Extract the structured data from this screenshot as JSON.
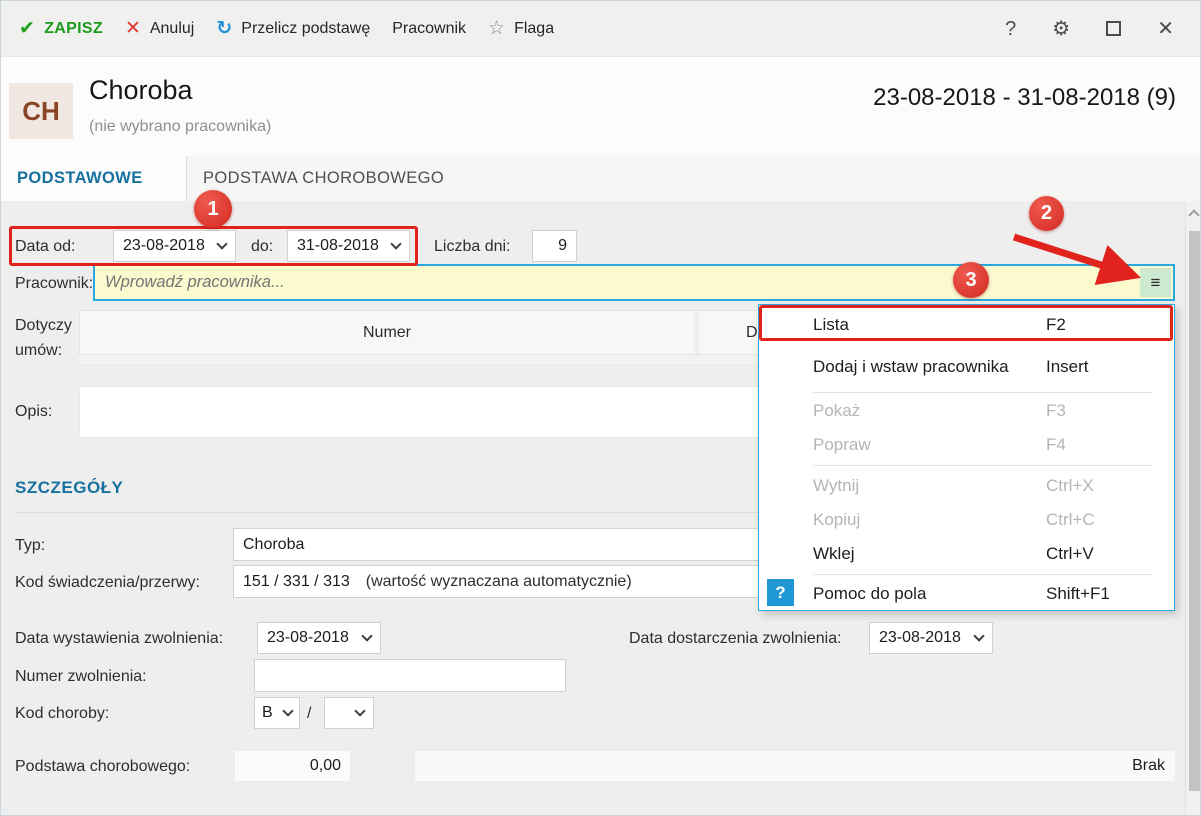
{
  "toolbar": {
    "save_label": "ZAPISZ",
    "cancel_label": "Anuluj",
    "recalc_label": "Przelicz podstawę",
    "employee_label": "Pracownik",
    "flag_label": "Flaga"
  },
  "icons": {
    "check": "✔",
    "x": "✕",
    "refresh": "↻",
    "star": "☆",
    "help": "?",
    "gear": "⚙",
    "close": "✕",
    "hamburger": "≡",
    "menu_help": "?"
  },
  "header": {
    "avatar": "CH",
    "title": "Choroba",
    "subtitle": "(nie wybrano pracownika)",
    "date_range": "23-08-2018 - 31-08-2018 (9)"
  },
  "tabs": {
    "active": "PODSTAWOWE",
    "inactive": "PODSTAWA CHOROBOWEGO"
  },
  "form": {
    "date_from_label": "Data od:",
    "date_from": "23-08-2018",
    "date_to_label": "do:",
    "date_to": "31-08-2018",
    "days_label": "Liczba dni:",
    "days": "9",
    "employee_label": "Pracownik:",
    "employee_placeholder": "Wprowadź pracownika...",
    "contracts_label": "Dotyczy umów:",
    "contracts_col1": "Numer",
    "contracts_col2": "D",
    "description_label": "Opis:",
    "details_heading": "SZCZEGÓŁY",
    "type_label": "Typ:",
    "type_value": "Choroba",
    "benefit_code_label": "Kod świadczenia/przerwy:",
    "benefit_code_value": "151 / 331 / 313",
    "benefit_code_note": "(wartość wyznaczana automatycznie)",
    "issue_date_label": "Data wystawienia zwolnienia:",
    "issue_date": "23-08-2018",
    "delivery_date_label": "Data dostarczenia zwolnienia:",
    "delivery_date": "23-08-2018",
    "release_number_label": "Numer zwolnienia:",
    "disease_code_label": "Kod choroby:",
    "disease_code": "B",
    "disease_code_separator": "/",
    "sickness_base_label": "Podstawa chorobowego:",
    "sickness_base_value": "0,00",
    "sickness_base_info": "Brak"
  },
  "menu": {
    "items": [
      {
        "label": "Lista",
        "shortcut": "F2",
        "enabled": true
      },
      {
        "label": "Dodaj i wstaw pracownika",
        "shortcut": "Insert",
        "enabled": true
      },
      {
        "label": "Pokaż",
        "shortcut": "F3",
        "enabled": false
      },
      {
        "label": "Popraw",
        "shortcut": "F4",
        "enabled": false
      },
      {
        "label": "Wytnij",
        "shortcut": "Ctrl+X",
        "enabled": false
      },
      {
        "label": "Kopiuj",
        "shortcut": "Ctrl+C",
        "enabled": false
      },
      {
        "label": "Wklej",
        "shortcut": "Ctrl+V",
        "enabled": true
      },
      {
        "label": "Pomoc do pola",
        "shortcut": "Shift+F1",
        "enabled": true
      }
    ]
  },
  "annotations": {
    "step1": "1",
    "step2": "2",
    "step3": "3"
  },
  "colors": {
    "accent_blue": "#29a9e0",
    "annotation_red": "#e0231c",
    "save_green": "#1d9b1d",
    "highlight_yellow": "#fbf9ce"
  }
}
